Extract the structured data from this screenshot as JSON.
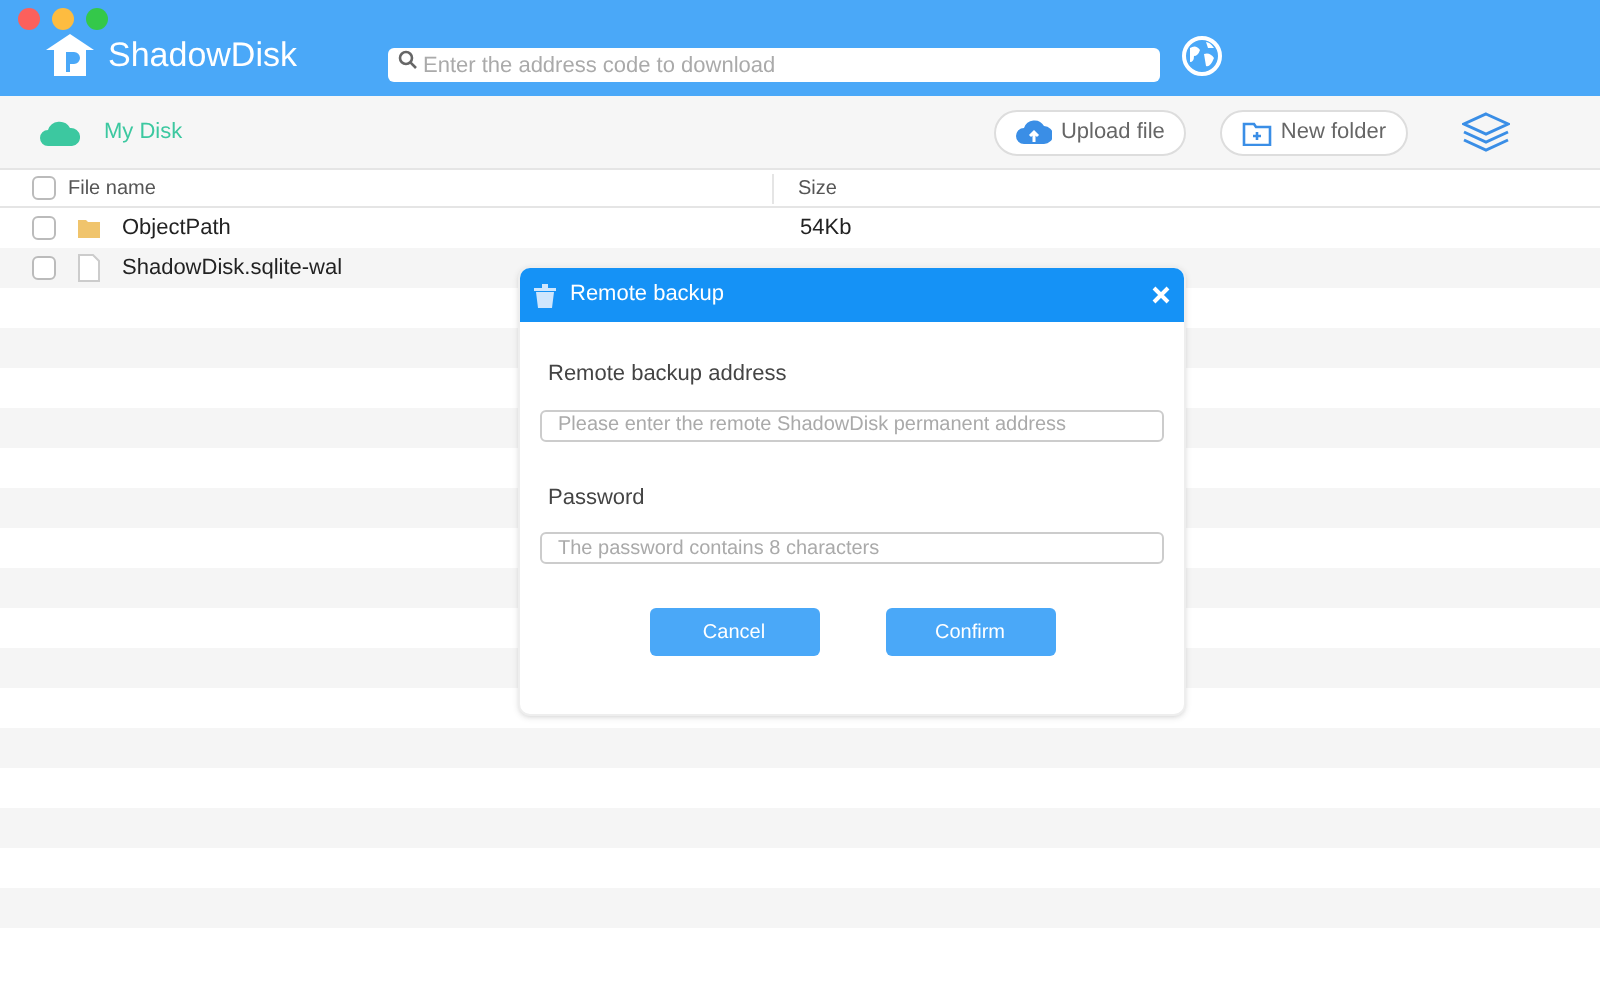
{
  "app": {
    "title": "ShadowDisk",
    "search_placeholder": "Enter the address code to download"
  },
  "toolbar": {
    "breadcrumb": "My Disk",
    "buttons": [
      {
        "kind": "upload",
        "label": "Upload file"
      },
      {
        "kind": "folder",
        "label": "New folder"
      }
    ]
  },
  "table": {
    "select_all": {
      "checked": false
    },
    "columns": [
      "File name",
      "Size"
    ],
    "rows": [
      {
        "kind": "folder",
        "name": "ObjectPath",
        "size": "54Kb",
        "checked": false
      },
      {
        "kind": "file",
        "name": "ShadowDisk.sqlite-wal",
        "checked": false
      }
    ]
  },
  "dialog": {
    "title": "Remote backup",
    "fields": [
      {
        "label": "Remote backup address",
        "placeholder": "Please enter the remote ShadowDisk permanent address"
      },
      {
        "label": "Password",
        "placeholder": "The password contains 8 characters"
      }
    ],
    "buttons": [
      "Cancel",
      "Confirm"
    ]
  }
}
